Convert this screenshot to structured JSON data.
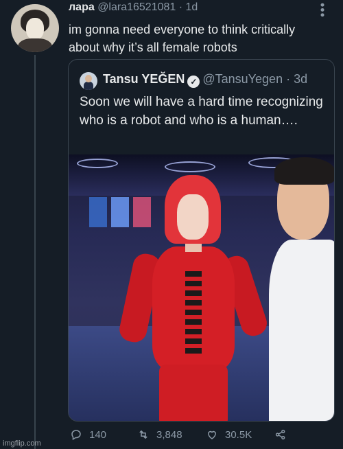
{
  "tweet": {
    "display_name": "лара",
    "handle": "@lara16521081",
    "time": "1d",
    "text": "im gonna need everyone to think critically about why it’s all female robots"
  },
  "quote": {
    "display_name": "Tansu YEĞEN",
    "handle": "@TansuYegen",
    "time": "3d",
    "text": "Soon we will have a hard time recognizing who is a robot and who is a human…."
  },
  "actions": {
    "replies": "140",
    "retweets": "3,848",
    "likes": "30.5K"
  },
  "icons": {
    "more": "more-vertical-icon",
    "verified": "verified-badge-icon",
    "reply": "reply-icon",
    "retweet": "retweet-icon",
    "like": "heart-icon",
    "share": "share-icon"
  },
  "watermark": "imgflip.com"
}
